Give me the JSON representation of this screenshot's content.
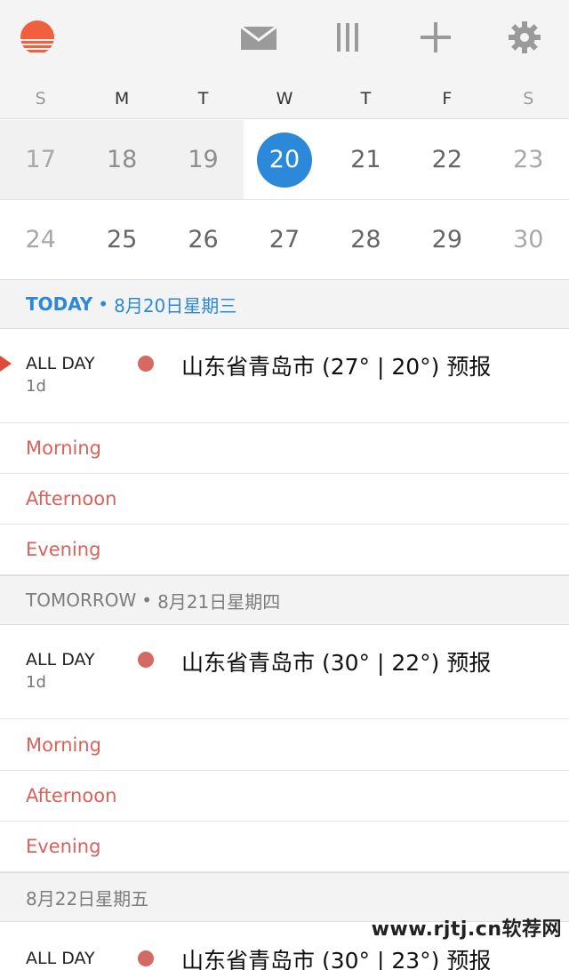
{
  "toolbar": {
    "icons": [
      "sunrise-logo",
      "mail-icon",
      "columns-icon",
      "plus-icon",
      "gear-icon"
    ]
  },
  "weekdays": [
    "S",
    "M",
    "T",
    "W",
    "T",
    "F",
    "S"
  ],
  "calendar": {
    "row1": [
      "17",
      "18",
      "19",
      "20",
      "21",
      "22",
      "23"
    ],
    "row2": [
      "24",
      "25",
      "26",
      "27",
      "28",
      "29",
      "30"
    ],
    "selected": "20"
  },
  "sections": [
    {
      "lead": "TODAY",
      "date": "8月20日星期三",
      "event": {
        "when": "ALL DAY",
        "duration": "1d",
        "title": "山东省青岛市 (27° | 20°) 预报"
      },
      "slots": [
        "Morning",
        "Afternoon",
        "Evening"
      ]
    },
    {
      "lead": "TOMORROW",
      "date": "8月21日星期四",
      "event": {
        "when": "ALL DAY",
        "duration": "1d",
        "title": "山东省青岛市 (30° | 22°) 预报"
      },
      "slots": [
        "Morning",
        "Afternoon",
        "Evening"
      ]
    },
    {
      "lead": "",
      "date": "8月22日星期五",
      "event": {
        "when": "ALL DAY",
        "duration": "",
        "title": "山东省青岛市 (30° | 23°) 预报"
      },
      "slots": []
    }
  ],
  "separator": "•",
  "watermark": "www.rjtj.cn软荐网",
  "colors": {
    "accent": "#2c88d9",
    "slot_text": "#d9625a",
    "event_dot": "#d46a61"
  }
}
